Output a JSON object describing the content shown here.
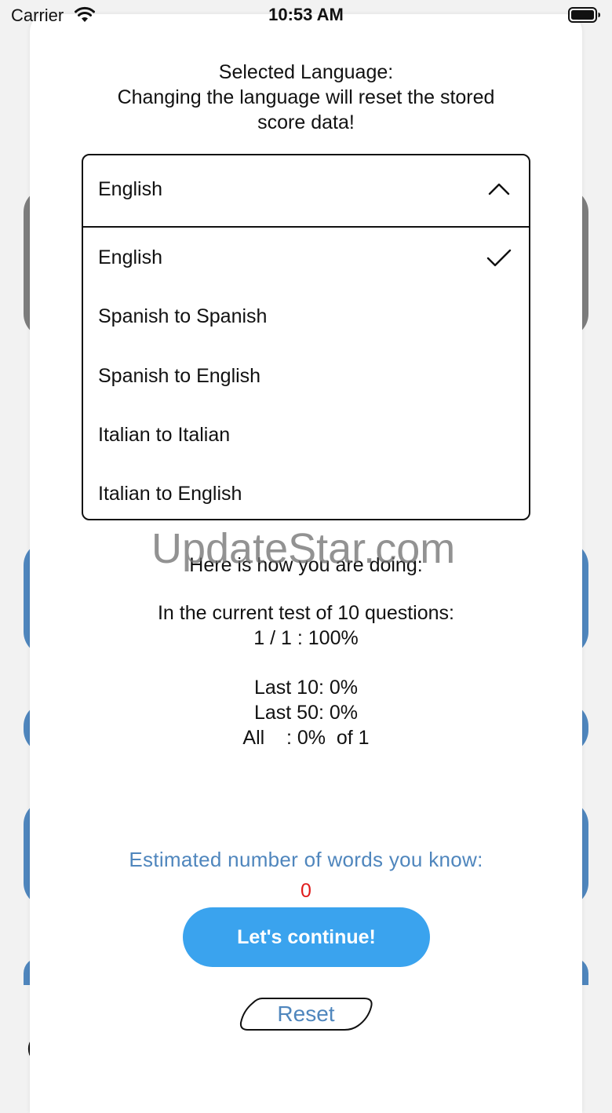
{
  "status_bar": {
    "carrier": "Carrier",
    "time": "10:53 AM"
  },
  "language": {
    "heading_line1": "Selected Language:",
    "heading_line2": "Changing the language will reset the stored",
    "heading_line3": "score data!",
    "selected": "English",
    "options": [
      {
        "label": "English",
        "checked": true
      },
      {
        "label": "Spanish to Spanish",
        "checked": false
      },
      {
        "label": "Spanish to English",
        "checked": false
      },
      {
        "label": "Italian to Italian",
        "checked": false
      },
      {
        "label": "Italian to English",
        "checked": false
      }
    ]
  },
  "watermark": "UpdateStar.com",
  "stats": {
    "intro": "Here is how you are doing:",
    "current_test": "In the current test of 10 questions:",
    "current_score": "1 / 1 : 100%",
    "last10": "Last 10: 0%",
    "last50": "Last 50: 0%",
    "all": "All    : 0%  of 1"
  },
  "estimate": {
    "label": "Estimated number of words you know:",
    "value": "0"
  },
  "buttons": {
    "continue_label": "Let's continue!",
    "reset_label": "Reset"
  },
  "background": {
    "paren": "("
  },
  "colors": {
    "accent_blue": "#3aa3ee",
    "link_blue": "#4f86bd",
    "value_red": "#e01b1b"
  }
}
